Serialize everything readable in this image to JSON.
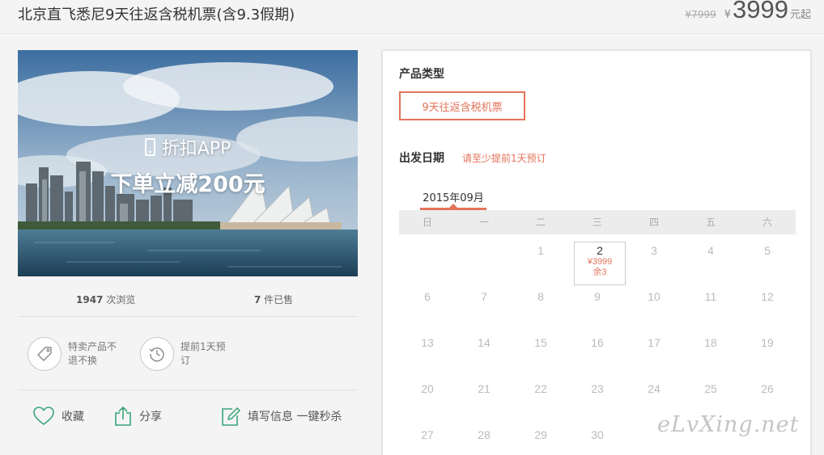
{
  "header": {
    "title": "北京直飞悉尼9天往返含税机票(含9.3假期)",
    "original_price": "¥7999",
    "currency": "¥",
    "price": "3999",
    "price_suffix": "元起"
  },
  "hero": {
    "line1": "折扣APP",
    "line2": "下单立减200元",
    "icon": "phone-icon"
  },
  "stats": {
    "views_count": "1947",
    "views_label": " 次浏览",
    "sold_count": "7",
    "sold_label": " 件已售"
  },
  "features": [
    {
      "icon": "price-tag-icon",
      "text": "特卖产品不退不换"
    },
    {
      "icon": "clock-history-icon",
      "text": "提前1天预订"
    }
  ],
  "actions": {
    "favorite": "收藏",
    "share": "分享",
    "fill_info": "填写信息 一键秒杀"
  },
  "booking": {
    "product_type_label": "产品类型",
    "product_type_option": "9天往返含税机票",
    "departure_label": "出发日期",
    "departure_hint": "请至少提前1天预订",
    "month": "2015年09月",
    "weekdays": [
      "日",
      "一",
      "二",
      "三",
      "四",
      "五",
      "六"
    ],
    "calendar": [
      [
        "",
        "",
        "1",
        "2",
        "3",
        "4",
        "5"
      ],
      [
        "6",
        "7",
        "8",
        "9",
        "10",
        "11",
        "12"
      ],
      [
        "13",
        "14",
        "15",
        "16",
        "17",
        "18",
        "19"
      ],
      [
        "20",
        "21",
        "22",
        "23",
        "24",
        "25",
        "26"
      ],
      [
        "27",
        "28",
        "29",
        "30",
        "",
        "",
        ""
      ]
    ],
    "available_day": {
      "day": "2",
      "price": "¥3999",
      "remaining": "余3"
    }
  },
  "watermark": "eLvXing.net",
  "colors": {
    "accent": "#e4735a",
    "icon_green": "#3aa57a"
  }
}
